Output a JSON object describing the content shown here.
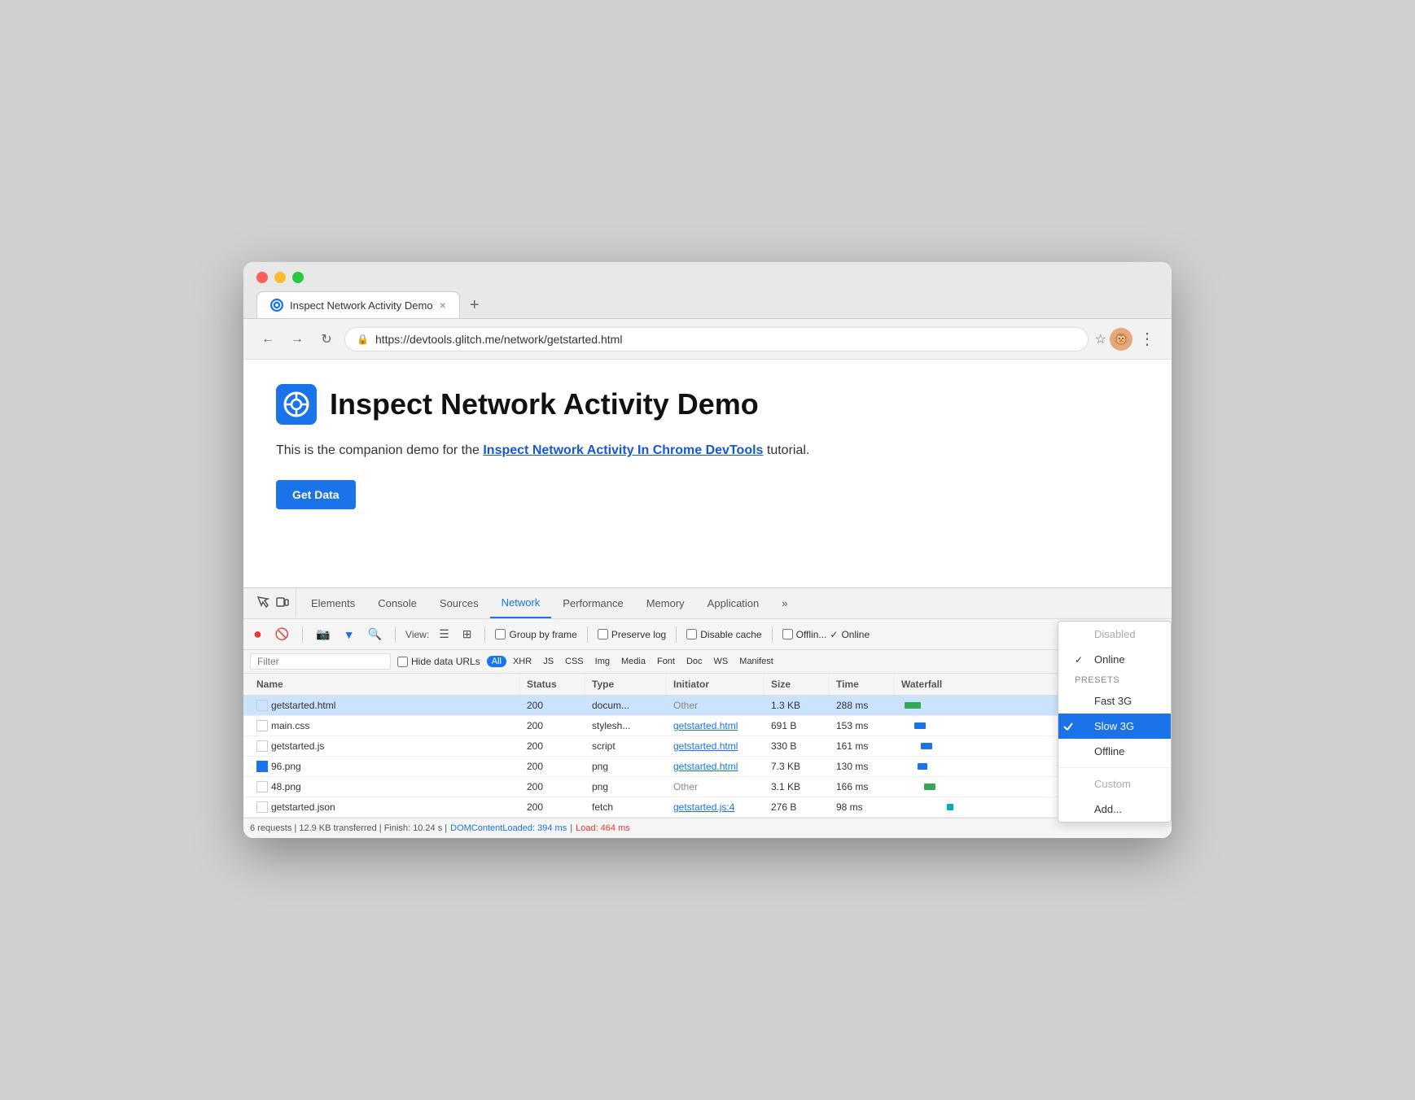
{
  "browser": {
    "traffic_lights": [
      "red",
      "yellow",
      "green"
    ],
    "tab": {
      "title": "Inspect Network Activity Demo",
      "close_label": "×",
      "new_tab_label": "+"
    },
    "address_bar": {
      "url": "https://devtools.glitch.me/network/getstarted.html",
      "lock_icon": "🔒",
      "star_icon": "☆"
    },
    "nav": {
      "back": "←",
      "forward": "→",
      "refresh": "↻"
    },
    "menu_dots": "⋮"
  },
  "page": {
    "title": "Inspect Network Activity Demo",
    "logo_icon": "⚙",
    "description_prefix": "This is the companion demo for the ",
    "link_text": "Inspect Network Activity In Chrome DevTools",
    "description_suffix": " tutorial.",
    "get_data_button": "Get Data"
  },
  "devtools": {
    "icon1": "⬡",
    "icon2": "⬢",
    "tabs": [
      {
        "label": "Elements",
        "active": false
      },
      {
        "label": "Console",
        "active": false
      },
      {
        "label": "Sources",
        "active": false
      },
      {
        "label": "Network",
        "active": true
      },
      {
        "label": "Performance",
        "active": false
      },
      {
        "label": "Memory",
        "active": false
      },
      {
        "label": "Application",
        "active": false
      },
      {
        "label": "»",
        "active": false
      }
    ]
  },
  "network_toolbar": {
    "record_label": "●",
    "clear_label": "🚫",
    "camera_label": "📷",
    "filter_label": "▼",
    "search_label": "🔍",
    "view_label": "View:",
    "list_icon": "☰",
    "tree_icon": "⊞",
    "group_by_frame": "Group by frame",
    "preserve_log": "Preserve log",
    "disable_cache": "Disable cache",
    "offline_label": "Offlin...",
    "checkmark": "✓",
    "throttle_label": "Online"
  },
  "filter_row": {
    "filter_placeholder": "Filter",
    "hide_data_urls": "Hide data URLs",
    "tags": [
      "All",
      "XHR",
      "JS",
      "CSS",
      "Img",
      "Media",
      "Font",
      "Doc",
      "WS",
      "Manifest"
    ],
    "active_tag": "All"
  },
  "table": {
    "headers": [
      "Name",
      "Status",
      "Type",
      "Initiator",
      "Size",
      "Time",
      "Waterfall"
    ],
    "rows": [
      {
        "icon": "default",
        "name": "getstarted.html",
        "status": "200",
        "type": "docum...",
        "initiator": "Other",
        "initiator_link": false,
        "size": "1.3 KB",
        "time": "288 ms",
        "selected": true,
        "waterfall_width": 20,
        "waterfall_color": "green"
      },
      {
        "icon": "default",
        "name": "main.css",
        "status": "200",
        "type": "stylesh...",
        "initiator": "getstarted.html",
        "initiator_link": true,
        "size": "691 B",
        "time": "153 ms",
        "selected": false,
        "waterfall_width": 14,
        "waterfall_color": "blue"
      },
      {
        "icon": "default",
        "name": "getstarted.js",
        "status": "200",
        "type": "script",
        "initiator": "getstarted.html",
        "initiator_link": true,
        "size": "330 B",
        "time": "161 ms",
        "selected": false,
        "waterfall_width": 14,
        "waterfall_color": "blue"
      },
      {
        "icon": "blue",
        "name": "96.png",
        "status": "200",
        "type": "png",
        "initiator": "getstarted.html",
        "initiator_link": true,
        "size": "7.3 KB",
        "time": "130 ms",
        "selected": false,
        "waterfall_width": 12,
        "waterfall_color": "blue"
      },
      {
        "icon": "default",
        "name": "48.png",
        "status": "200",
        "type": "png",
        "initiator": "Other",
        "initiator_link": false,
        "size": "3.1 KB",
        "time": "166 ms",
        "selected": false,
        "waterfall_width": 14,
        "waterfall_color": "green"
      },
      {
        "icon": "default",
        "name": "getstarted.json",
        "status": "200",
        "type": "fetch",
        "initiator": "getstarted.js:4",
        "initiator_link": true,
        "size": "276 B",
        "time": "98 ms",
        "selected": false,
        "waterfall_width": 8,
        "waterfall_color": "blue"
      }
    ]
  },
  "status_bar": {
    "text": "6 requests | 12.9 KB transferred | Finish: 10.24 s | ",
    "dom_label": "DOMContentLoaded: 394 ms",
    "separator": " | ",
    "load_label": "Load: 464 ms"
  },
  "dropdown": {
    "items": [
      {
        "label": "Disabled",
        "type": "disabled",
        "checked": false
      },
      {
        "label": "Online",
        "type": "normal",
        "checked": true
      },
      {
        "label": "Presets",
        "type": "section",
        "checked": false
      },
      {
        "label": "Fast 3G",
        "type": "normal",
        "checked": false
      },
      {
        "label": "Slow 3G",
        "type": "active",
        "checked": false
      },
      {
        "label": "Offline",
        "type": "normal",
        "checked": false
      },
      {
        "label": "Custom",
        "type": "disabled",
        "checked": false
      },
      {
        "label": "Add...",
        "type": "normal",
        "checked": false
      }
    ]
  }
}
